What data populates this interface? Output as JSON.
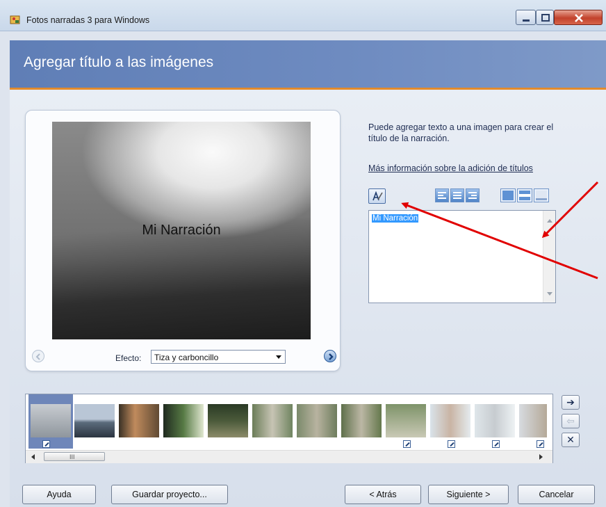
{
  "window": {
    "title": "Fotos narradas 3 para Windows",
    "controls": [
      "minimize",
      "maximize",
      "close"
    ]
  },
  "header": {
    "title": "Agregar título a las imágenes",
    "accent_color": "#e38b2c"
  },
  "preview": {
    "caption": "Mi Narración",
    "effect_label": "Efecto:",
    "effect_value": "Tiza y carboncillo"
  },
  "info": {
    "description": "Puede agregar texto a una imagen para crear el título de la narración.",
    "link": "Más información sobre la adición de títulos"
  },
  "toolbar": {
    "font_button": "font-icon",
    "align_buttons": [
      "align-left-icon",
      "align-center-icon",
      "align-right-icon"
    ],
    "position_buttons": [
      "position-top-icon",
      "position-middle-icon",
      "position-bottom-icon"
    ]
  },
  "text_input": {
    "value": "Mi Narración"
  },
  "filmstrip": {
    "thumbnails": [
      {
        "has_title": true,
        "selected": true
      },
      {
        "has_title": false
      },
      {
        "has_title": false
      },
      {
        "has_title": false
      },
      {
        "has_title": false
      },
      {
        "has_title": false
      },
      {
        "has_title": false
      },
      {
        "has_title": false
      },
      {
        "has_title": true
      },
      {
        "has_title": true
      },
      {
        "has_title": true
      },
      {
        "has_title": true
      }
    ],
    "scrollbar_grip": "III"
  },
  "side_buttons": {
    "next": "➔",
    "prev": "⇦",
    "remove": "✕"
  },
  "buttons": {
    "help": "Ayuda",
    "save_project": "Guardar proyecto...",
    "back": "< Atrás",
    "next": "Siguiente >",
    "cancel": "Cancelar"
  },
  "colors": {
    "annotation_arrow": "#e10000",
    "selection": "#3399ff"
  }
}
